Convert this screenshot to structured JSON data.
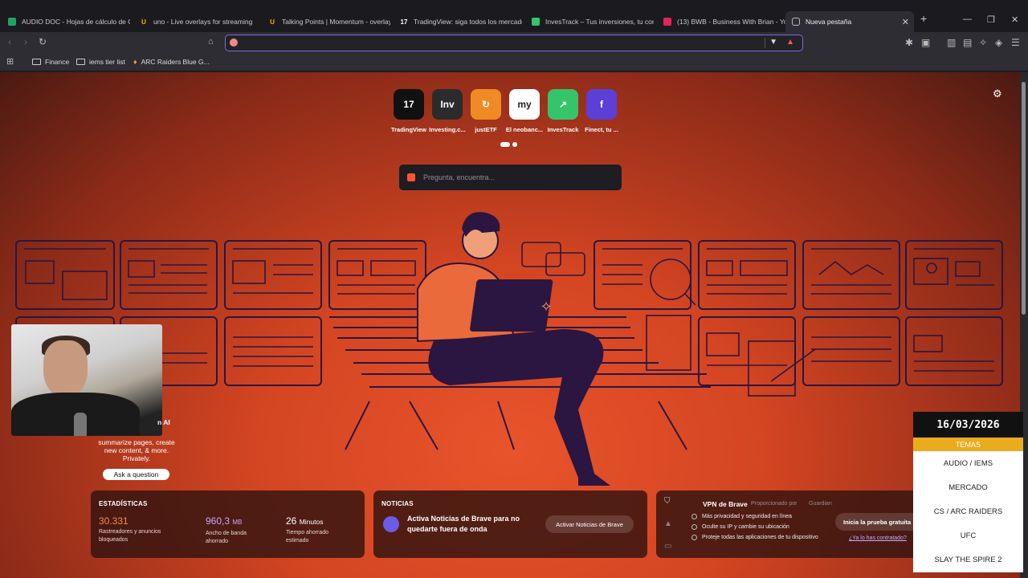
{
  "browser": {
    "tabs": [
      {
        "title": "AUDIO DOC - Hojas de cálculo de G",
        "icon": "sheets-icon",
        "color": "#1fa463"
      },
      {
        "title": "uno - Live overlays for streaming",
        "icon": "uno-icon",
        "color": "#f5b400"
      },
      {
        "title": "Talking Points | Momentum - overlay",
        "icon": "momentum-icon",
        "color": "#f5b400"
      },
      {
        "title": "TradingView: siga todos los mercado",
        "icon": "tradingview-icon",
        "color": "#ffffff"
      },
      {
        "title": "InvesTrack – Tus inversiones, tu com",
        "icon": "investrack-icon",
        "color": "#35c46a"
      },
      {
        "title": "(13) BWB - Business With Brian - You",
        "icon": "youtube-icon",
        "color": "#ff0000"
      },
      {
        "title": "Nueva pestaña",
        "icon": "brave-shield-icon",
        "color": "#bbbbbb"
      }
    ],
    "address": "",
    "bookmarks": [
      {
        "label": "Finance",
        "icon": "folder-icon"
      },
      {
        "label": "iems tier list",
        "icon": "folder-icon"
      },
      {
        "label": "ARC Raiders Blue G...",
        "icon": "arc-icon"
      }
    ]
  },
  "newtab": {
    "top_sites": [
      {
        "label": "TradingView",
        "glyph": "17",
        "bg": "#111111",
        "fg": "#ffffff"
      },
      {
        "label": "Investing.c...",
        "glyph": "Inv",
        "bg": "#2b2b2b",
        "fg": "#ffffff"
      },
      {
        "label": "justETF",
        "glyph": "↻",
        "bg": "#f08a24",
        "fg": "#ffffff"
      },
      {
        "label": "El neobanc...",
        "glyph": "my",
        "bg": "#ffffff",
        "fg": "#222222"
      },
      {
        "label": "InvesTrack",
        "glyph": "↗",
        "bg": "#35c46a",
        "fg": "#ffffff"
      },
      {
        "label": "Finect, tu ...",
        "glyph": "f",
        "bg": "#5b3fd6",
        "fg": "#ffffff"
      }
    ],
    "search_placeholder": "Pregunta, encuentra...",
    "leo": {
      "ai_label": "n AI",
      "text": "summarize pages, create new content, & more. Privately.",
      "button": "Ask a question"
    },
    "stats": {
      "title": "ESTADÍSTICAS",
      "trackers": {
        "value": "30.331",
        "label": "Rastreadores y anuncios bloqueados"
      },
      "bandwidth": {
        "value": "960,3",
        "unit": "MB",
        "label": "Ancho de banda ahorrado"
      },
      "time": {
        "value": "26",
        "unit": "Minutos",
        "label": "Tiempo ahorrado estimado"
      }
    },
    "news": {
      "title": "NOTICIAS",
      "text": "Activa Noticias de Brave para no quedarte fuera de onda",
      "button": "Activar Noticias de Brave"
    },
    "vpn": {
      "title": "VPN de Brave",
      "provider": "Proporcionado por",
      "provider_name": "Guardian",
      "bullets": [
        "Más privacidad y seguridad en línea",
        "Oculte su IP y cambie su ubicación",
        "Proteje todas las aplicaciones de tu dispositivo"
      ],
      "button": "Inicia la prueba gratuita",
      "link": "¿Ya lo has contratado?"
    }
  },
  "overlay": {
    "date": "16/03/2026",
    "header": "TEMAS",
    "topics": [
      "AUDIO / IEMS",
      "MERCADO",
      "CS / ARC RAIDERS",
      "UFC",
      "SLAY THE SPIRE 2"
    ]
  }
}
